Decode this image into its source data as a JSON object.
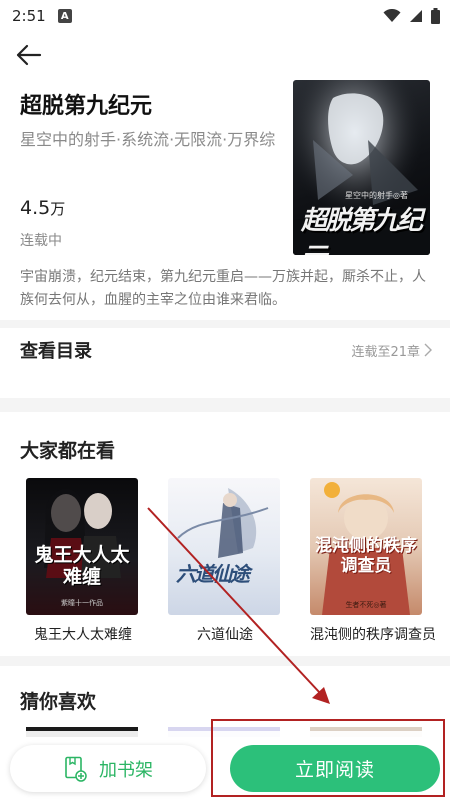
{
  "status_bar": {
    "time": "2:51",
    "badge": "A"
  },
  "book": {
    "title": "超脱第九纪元",
    "tags": "星空中的射手·系统流·无限流·万界综",
    "word_count": "4.5",
    "word_unit": "万",
    "status": "连载中",
    "description": "宇宙崩溃，纪元结束，第九纪元重启——万族并起，厮杀不止，人族何去何从，血腥的主宰之位由谁来君临。",
    "cover": {
      "title_text": "超脱第九纪元",
      "author_text": "星空中的射手◎著"
    }
  },
  "catalog": {
    "label": "查看目录",
    "update": "连载至21章"
  },
  "popular": {
    "title": "大家都在看",
    "books": [
      {
        "name": "鬼王大人太难缠",
        "cover_text": "鬼王大人太难缠",
        "cover_sub": "紫瞳十一作品"
      },
      {
        "name": "六道仙途",
        "cover_text": "六道仙途"
      },
      {
        "name": "混沌侧的秩序调查员",
        "cover_text": "混沌侧的秩序调查员",
        "cover_sub": "生者不死◎著"
      }
    ]
  },
  "guess": {
    "title": "猜你喜欢"
  },
  "actions": {
    "add_shelf": "加书架",
    "read_now": "立即阅读"
  },
  "colors": {
    "accent": "#2cc07a",
    "accent_text": "#2bb564",
    "annotation": "#b22222"
  },
  "icons": {
    "back": "arrow-left-icon",
    "wifi": "wifi-icon",
    "signal": "signal-icon",
    "battery": "battery-icon",
    "shelf": "add-to-shelf-icon",
    "chevron": "chevron-right-icon"
  }
}
